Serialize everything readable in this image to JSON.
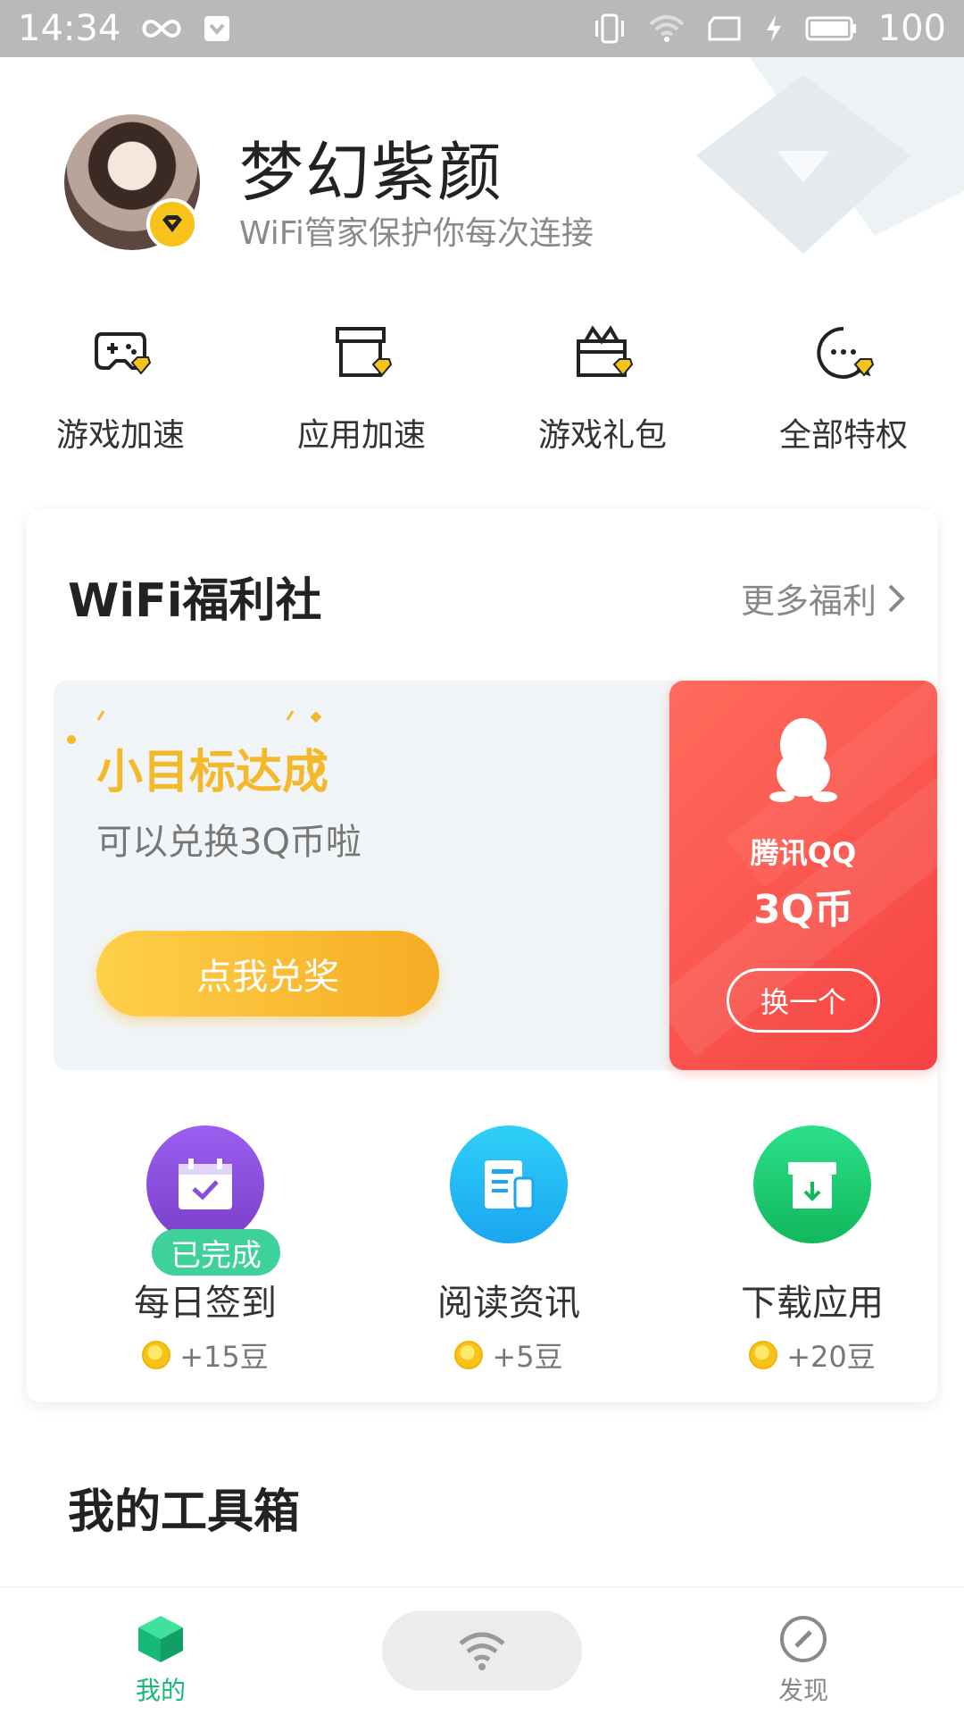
{
  "status_bar": {
    "time": "14:34",
    "battery": "100"
  },
  "profile": {
    "name": "梦幻紫颜",
    "subtitle": "WiFi管家保护你每次连接"
  },
  "quick_actions": [
    {
      "label": "游戏加速",
      "icon": "gamepad-icon"
    },
    {
      "label": "应用加速",
      "icon": "app-box-icon"
    },
    {
      "label": "游戏礼包",
      "icon": "gift-box-icon"
    },
    {
      "label": "全部特权",
      "icon": "more-chat-icon"
    }
  ],
  "welfare": {
    "title": "WiFi福利社",
    "more": "更多福利",
    "promo": {
      "title": "小目标达成",
      "subtitle": "可以兑换3Q币啦",
      "button": "点我兑奖"
    },
    "reward_card": {
      "name": "腾讯QQ",
      "value": "3Q币",
      "button": "换一个"
    },
    "tasks": [
      {
        "label": "每日签到",
        "reward": "+15豆",
        "badge": "已完成",
        "color": "#8a4fd8"
      },
      {
        "label": "阅读资讯",
        "reward": "+5豆",
        "color": "#1aa6f0"
      },
      {
        "label": "下载应用",
        "reward": "+20豆",
        "color": "#18c46c"
      }
    ]
  },
  "toolbox": {
    "title": "我的工具箱"
  },
  "bottom_nav": {
    "mine": "我的",
    "discover": "发现"
  },
  "colors": {
    "accent_green": "#16b978",
    "promo_yellow": "#f4b92a",
    "reward_red": "#f64343"
  }
}
